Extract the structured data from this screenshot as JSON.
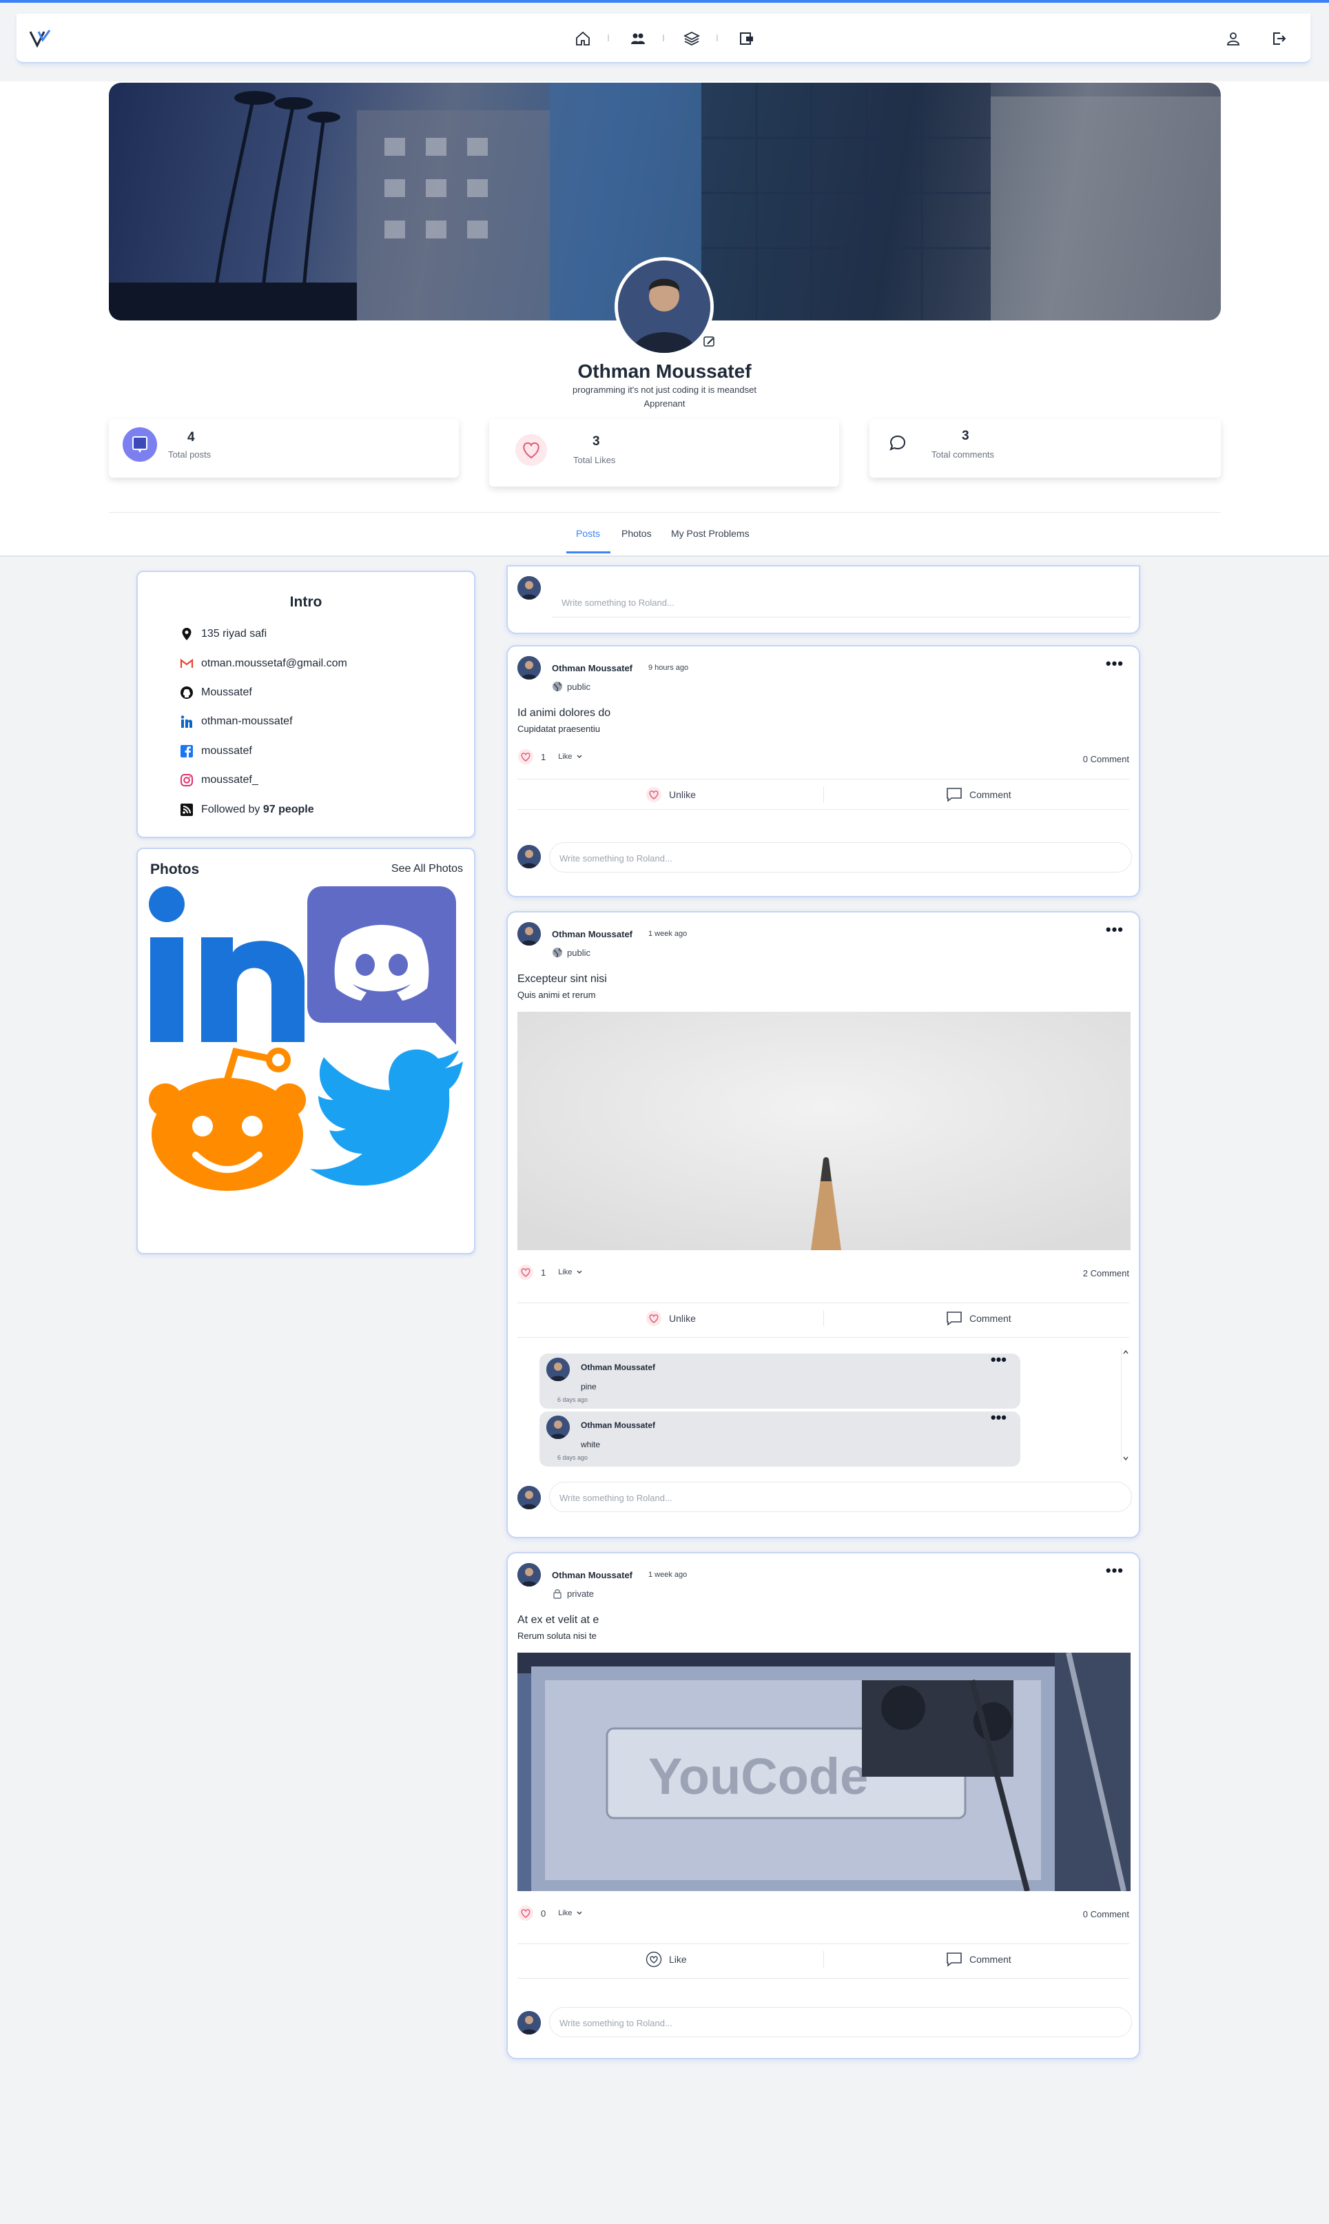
{
  "nav": {
    "logo": "logo-icon",
    "icons": [
      "home-icon",
      "users-icon",
      "layers-icon",
      "wallet-icon"
    ],
    "right_icons": [
      "user-icon",
      "logout-icon"
    ]
  },
  "profile": {
    "name": "Othman Moussatef",
    "bio": "programming it's not just coding it is meandset",
    "role": "Apprenant",
    "stats": [
      {
        "value": "4",
        "label": "Total posts"
      },
      {
        "value": "3",
        "label": "Total Likes"
      },
      {
        "value": "3",
        "label": "Total comments"
      }
    ],
    "tabs": [
      "Posts",
      "Photos",
      "My Post Problems"
    ],
    "active_tab": "Posts"
  },
  "intro": {
    "title": "Intro",
    "address": "135 riyad safi",
    "email": "otman.moussetaf@gmail.com",
    "github": "Moussatef",
    "linkedin": "othman-moussatef",
    "facebook": "moussatef",
    "instagram": "moussatef_",
    "followed_prefix": "Followed by",
    "followed_count": "97 people"
  },
  "photos": {
    "title": "Photos",
    "see_all": "See All Photos",
    "items": [
      "LinkedIn logo",
      "Discord logo",
      "Reddit logo",
      "Twitter logo"
    ]
  },
  "composer": {
    "placeholder": "Write something to Roland..."
  },
  "posts": [
    {
      "author": "Othman Moussatef",
      "time": "9 hours ago",
      "visibility": "public",
      "title": "Id animi dolores do",
      "body": "Cupidatat praesentiu",
      "likes": "1",
      "like_label": "Like",
      "comments_label": "0 Comment",
      "action_like": "Unlike",
      "action_comment": "Comment",
      "reply_placeholder": "Write something to Roland..."
    },
    {
      "author": "Othman Moussatef",
      "time": "1 week ago",
      "visibility": "public",
      "title": "Excepteur sint nisi",
      "body": "Quis animi et rerum",
      "image": "pencil tip on white paper",
      "likes": "1",
      "like_label": "Like",
      "comments_label": "2 Comment",
      "action_like": "Unlike",
      "action_comment": "Comment",
      "comments": [
        {
          "author": "Othman Moussatef",
          "text": "pine",
          "time": "6 days ago"
        },
        {
          "author": "Othman Moussatef",
          "text": "white",
          "time": "6 days ago"
        }
      ],
      "reply_placeholder": "Write something to Roland..."
    },
    {
      "author": "Othman Moussatef",
      "time": "1 week ago",
      "visibility": "private",
      "title": "At ex et velit at e",
      "body": "Rerum soluta nisi te",
      "image": "3D printer printing YouCode plate",
      "likes": "0",
      "like_label": "Like",
      "comments_label": "0 Comment",
      "action_like": "Like",
      "action_comment": "Comment",
      "reply_placeholder": "Write something to Roland..."
    }
  ],
  "colors": {
    "accent": "#3b82f6",
    "like": "#e05a74",
    "linkedin": "#0a66c2",
    "discord": "#5865f2",
    "reddit": "#ff8b00",
    "twitter": "#1da1f2"
  }
}
